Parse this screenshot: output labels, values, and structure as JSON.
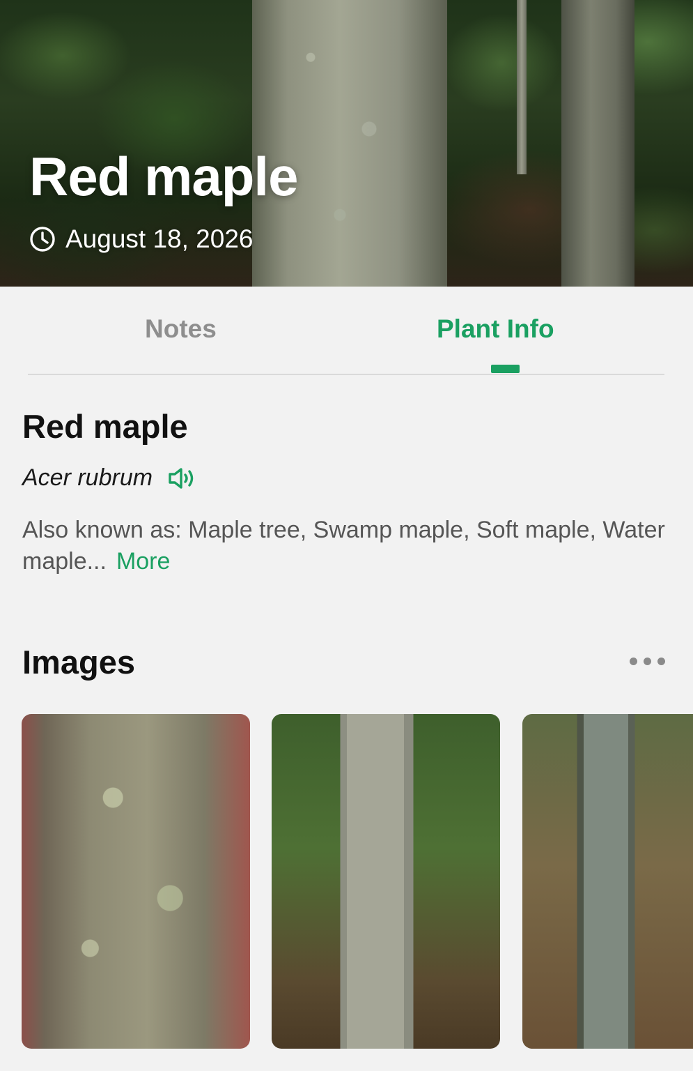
{
  "hero": {
    "title": "Red maple",
    "date": "August 18, 2026"
  },
  "tabs": [
    {
      "label": "Notes",
      "active": false
    },
    {
      "label": "Plant Info",
      "active": true
    }
  ],
  "info": {
    "common_name": "Red maple",
    "scientific_name": "Acer rubrum",
    "aka_text": "Also known as: Maple tree, Swamp maple, Soft maple, Water maple...",
    "more_label": "More"
  },
  "images_section": {
    "title": "Images"
  },
  "icons": {
    "clock": "clock-icon",
    "speaker": "speaker-icon",
    "more": "more-dots-icon"
  },
  "colors": {
    "accent": "#1aa061",
    "inactive_tab": "#8e8e8e",
    "background": "#f2f2f2"
  }
}
